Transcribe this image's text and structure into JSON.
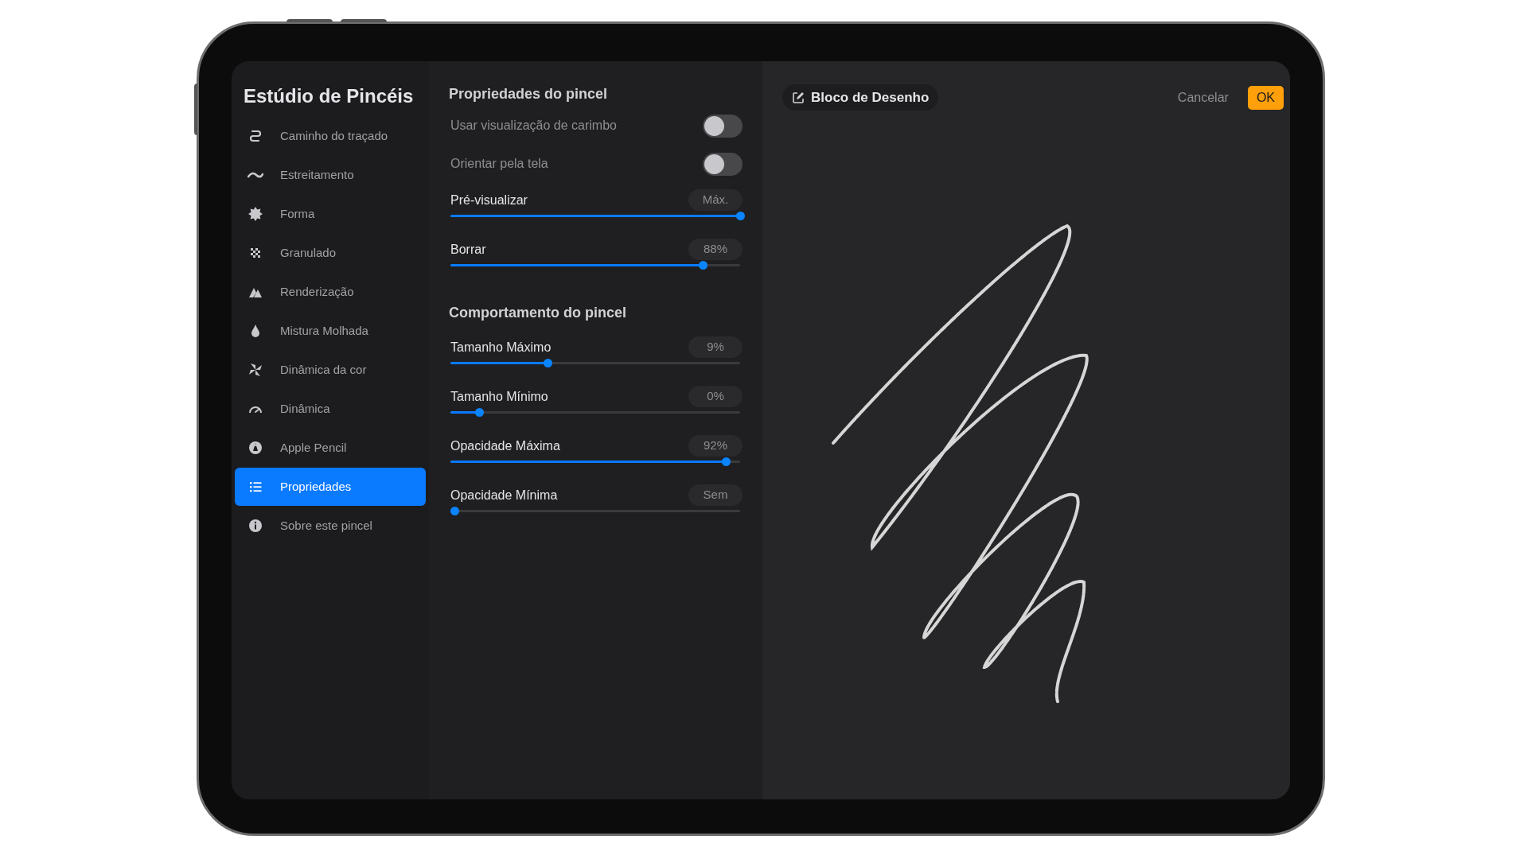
{
  "sidebar": {
    "title": "Estúdio de Pincéis",
    "items": [
      {
        "label": "Caminho do traçado",
        "selected": false
      },
      {
        "label": "Estreitamento",
        "selected": false
      },
      {
        "label": "Forma",
        "selected": false
      },
      {
        "label": "Granulado",
        "selected": false
      },
      {
        "label": "Renderização",
        "selected": false
      },
      {
        "label": "Mistura Molhada",
        "selected": false
      },
      {
        "label": "Dinâmica da cor",
        "selected": false
      },
      {
        "label": "Dinâmica",
        "selected": false
      },
      {
        "label": "Apple Pencil",
        "selected": false
      },
      {
        "label": "Propriedades",
        "selected": true
      },
      {
        "label": "Sobre este pincel",
        "selected": false
      }
    ]
  },
  "properties": {
    "sections": [
      {
        "title": "Propriedades do pincel",
        "rows": [
          {
            "kind": "toggle",
            "label": "Usar visualização de carimbo",
            "on": false
          },
          {
            "kind": "toggle",
            "label": "Orientar pela tela",
            "on": false
          },
          {
            "kind": "slider",
            "label": "Pré-visualizar",
            "value": "Máx.",
            "level": 1.0
          },
          {
            "kind": "slider",
            "label": "Borrar",
            "value": "88%",
            "level": 0.87
          }
        ]
      },
      {
        "title": "Comportamento do pincel",
        "rows": [
          {
            "kind": "slider",
            "label": "Tamanho Máximo",
            "value": "9%",
            "level": 0.335
          },
          {
            "kind": "slider",
            "label": "Tamanho Mínimo",
            "value": "0%",
            "level": 0.1
          },
          {
            "kind": "slider",
            "label": "Opacidade Máxima",
            "value": "92%",
            "level": 0.95
          },
          {
            "kind": "slider",
            "label": "Opacidade Mínima",
            "value": "Sem",
            "level": 0.015
          }
        ]
      }
    ]
  },
  "canvas": {
    "title": "Bloco de Desenho",
    "cancel": "Cancelar",
    "ok": "OK"
  }
}
